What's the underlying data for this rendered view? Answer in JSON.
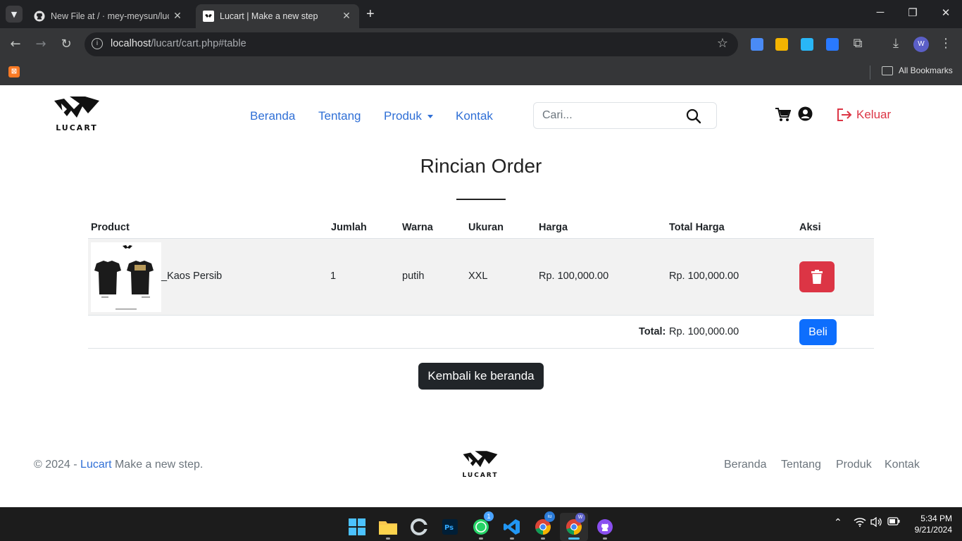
{
  "browser": {
    "tabs": [
      {
        "title": "New File at / · mey-meysun/lucart"
      },
      {
        "title": "Lucart | Make a new step"
      }
    ],
    "url_host": "localhost",
    "url_path": "/lucart/cart.php#table",
    "bookmarks_all": "All Bookmarks",
    "profile_initial": "W"
  },
  "header": {
    "logo_text": "LUCART",
    "nav": [
      {
        "label": "Beranda"
      },
      {
        "label": "Tentang"
      },
      {
        "label": "Produk"
      },
      {
        "label": "Kontak"
      }
    ],
    "search_placeholder": "Cari...",
    "logout_label": "Keluar"
  },
  "order": {
    "title": "Rincian Order",
    "columns": [
      "Product",
      "Jumlah",
      "Warna",
      "Ukuran",
      "Harga",
      "Total Harga",
      "Aksi"
    ],
    "items": [
      {
        "product": "_Kaos Persib",
        "qty": "1",
        "color": "putih",
        "size": "XXL",
        "price": "Rp. 100,000.00",
        "total": "Rp. 100,000.00"
      }
    ],
    "total_label": "Total:",
    "total_value": "Rp. 100,000.00",
    "buy_label": "Beli",
    "back_label": "Kembali ke beranda"
  },
  "footer": {
    "copyright_prefix": "© 2024 - ",
    "brand": "Lucart",
    "copyright_suffix": " Make a new step.",
    "logo_text": "LUCART",
    "links": [
      {
        "label": "Beranda"
      },
      {
        "label": "Tentang"
      },
      {
        "label": "Produk"
      },
      {
        "label": "Kontak"
      }
    ]
  },
  "taskbar": {
    "whatsapp_badge": "1",
    "chrome_badge": "iu",
    "chrome_active_badge": "W",
    "time": "5:34 PM",
    "date": "9/21/2024"
  },
  "colors": {
    "link_blue": "#2f6fd6",
    "danger": "#dc3545",
    "primary": "#0d6efd",
    "dark": "#212529"
  }
}
